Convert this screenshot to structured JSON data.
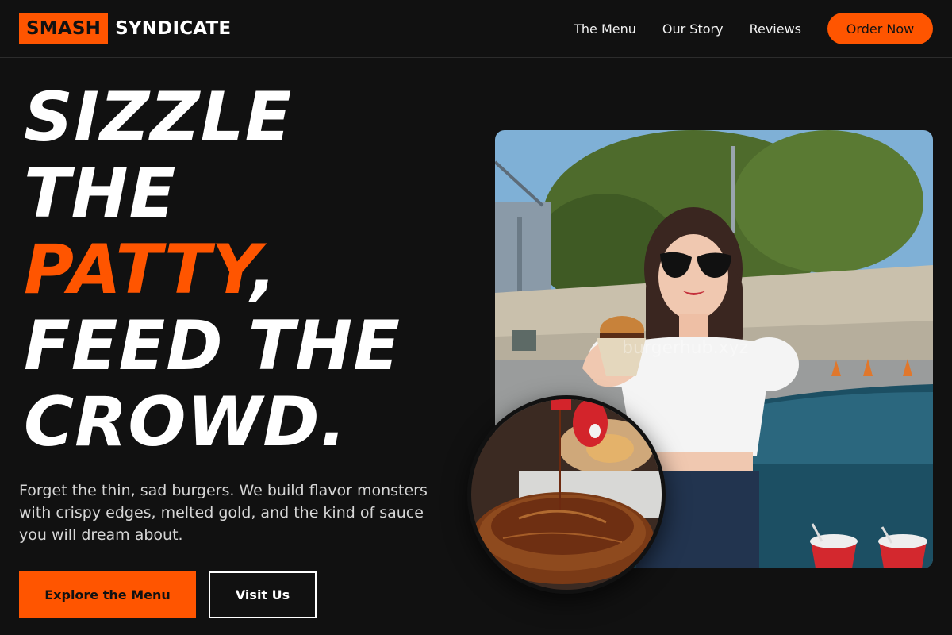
{
  "brand": {
    "mark": "SMASH",
    "name": "SYNDICATE"
  },
  "nav": {
    "links": [
      "The Menu",
      "Our Story",
      "Reviews"
    ],
    "cta": "Order Now"
  },
  "hero": {
    "headline": {
      "line1": "SIZZLE",
      "line2": "THE",
      "accent": "PATTY",
      "accent_tail": ",",
      "line4": "FEED THE",
      "line5": "CROWD."
    },
    "tagline": "Forget the thin, sad burgers. We build flavor monsters with crispy edges, melted gold, and the kind of sauce you will dream about.",
    "primary_button": "Explore the Menu",
    "secondary_button": "Visit Us",
    "photo_watermark": "burgerhub.xyz"
  },
  "colors": {
    "accent": "#ff5500",
    "background": "#111111",
    "text": "#ffffff"
  }
}
